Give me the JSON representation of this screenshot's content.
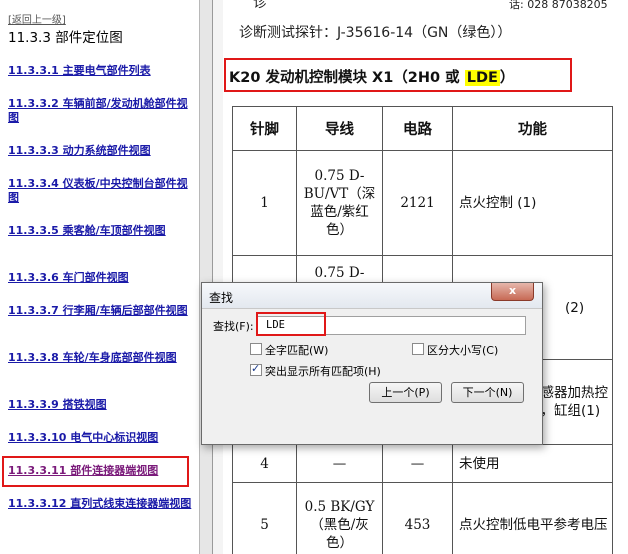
{
  "toc": {
    "back_link": "[返回上一级]",
    "title": "11.3.3 部件定位图",
    "items": [
      {
        "label": "11.3.3.1 主要电气部件列表"
      },
      {
        "label": "11.3.3.2 车辆前部/发动机舱部件视图"
      },
      {
        "label": "11.3.3.3 动力系统部件视图"
      },
      {
        "label": "11.3.3.4 仪表板/中央控制台部件视图"
      },
      {
        "label": "11.3.3.5 乘客舱/车顶部件视图"
      },
      {
        "label": "11.3.3.6 车门部件视图"
      },
      {
        "label": "11.3.3.7 行李厢/车辆后部部件视图"
      },
      {
        "label": "11.3.3.8 车轮/车身底部部件视图"
      },
      {
        "label": "11.3.3.9 搭铁视图"
      },
      {
        "label": "11.3.3.10 电气中心标识视图"
      },
      {
        "label": "11.3.3.11 部件连接器端视图"
      },
      {
        "label": "11.3.3.12 直列式线束连接器端视图"
      }
    ]
  },
  "doc": {
    "top_cut_text": "诊",
    "top_right_cut_text": "话: 028 87038205",
    "probe_line": "诊断测试探针：J-35616-14（GN（绿色））",
    "section_title_prefix": "K20 发动机控制模块 X1（2H0 或 ",
    "section_title_highlight": "LDE",
    "section_title_suffix": "）",
    "table": {
      "headers": [
        "针脚",
        "导线",
        "电路",
        "功能"
      ],
      "rows": [
        {
          "pin": "1",
          "wire": "0.75 D-BU/VT（深蓝色/紫红色）",
          "circuit": "2121",
          "function": "点火控制 (1)"
        },
        {
          "pin": "",
          "wire": "0.75 D-",
          "circuit": "",
          "function": "(2)"
        },
        {
          "pin": "",
          "wire": "",
          "circuit": "",
          "function": "传感器加热控制，缸组(1)"
        },
        {
          "pin": "4",
          "wire": "—",
          "circuit": "—",
          "function": "未使用"
        },
        {
          "pin": "5",
          "wire": "0.5 BK/GY（黑色/灰色）",
          "circuit": "453",
          "function": "点火控制低电平参考电压"
        }
      ]
    }
  },
  "find_dialog": {
    "title": "查找",
    "close_glyph": "x",
    "find_label": "查找(F):",
    "find_value": "LDE",
    "option_whole_word": "全字匹配(W)",
    "option_match_case": "区分大小写(C)",
    "option_highlight_all": "突出显示所有匹配项(H)",
    "prev_button": "上一个(P)",
    "next_button": "下一个(N)"
  }
}
